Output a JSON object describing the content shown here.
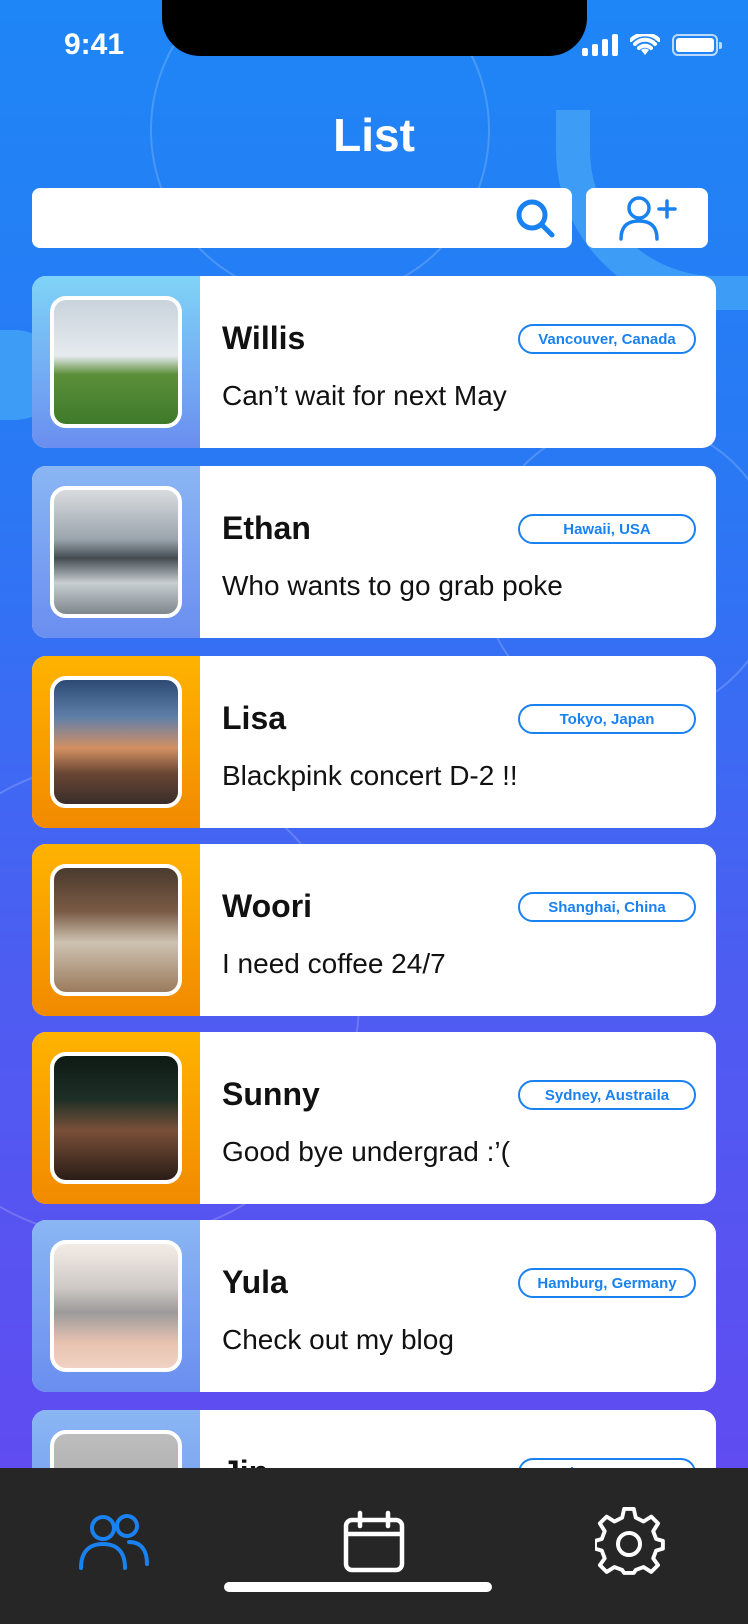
{
  "status_bar": {
    "time": "9:41"
  },
  "header": {
    "title": "List"
  },
  "search": {
    "placeholder": "",
    "value": ""
  },
  "colors": {
    "accent": "#1a82f0",
    "tab_bar": "#262626",
    "active_tab": "#1a82f0"
  },
  "contacts": [
    {
      "name": "Willis",
      "message": "Can’t wait for next May",
      "location": "Vancouver, Canada",
      "photo": "golfer-photo",
      "theme": "blue"
    },
    {
      "name": "Ethan",
      "message": "Who wants to go grab poke",
      "location": "Hawaii, USA",
      "photo": "ocean-photo",
      "theme": "blue"
    },
    {
      "name": "Lisa",
      "message": "Blackpink concert D-2 !!",
      "location": "Tokyo, Japan",
      "photo": "pagoda-photo",
      "theme": "orange"
    },
    {
      "name": "Woori",
      "message": "I need coffee 24/7",
      "location": "Shanghai, China",
      "photo": "cafe-photo",
      "theme": "orange"
    },
    {
      "name": "Sunny",
      "message": "Good bye undergrad :’(",
      "location": "Sydney, Austraila",
      "photo": "graduate-photo",
      "theme": "orange"
    },
    {
      "name": "Yula",
      "message": "Check out my blog",
      "location": "Hamburg, Germany",
      "photo": "laptop-photo",
      "theme": "blue"
    },
    {
      "name": "Jin",
      "message": "",
      "location": "Hamburg, Germany",
      "photo": "blank-photo",
      "theme": "blue"
    }
  ],
  "tabs": [
    {
      "icon": "friends-icon",
      "active": true
    },
    {
      "icon": "calendar-icon",
      "active": false
    },
    {
      "icon": "settings-icon",
      "active": false
    }
  ]
}
